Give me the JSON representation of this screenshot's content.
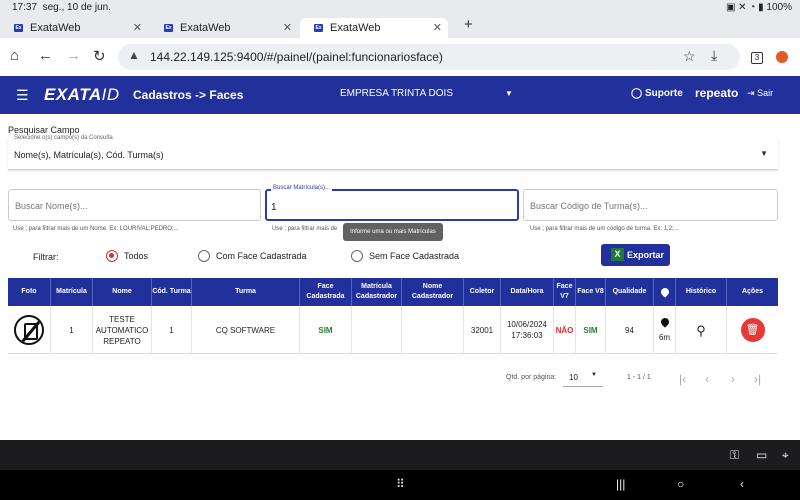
{
  "statusbar": {
    "time": "17:37",
    "date": "seg., 10 de jun.",
    "battery": "100%"
  },
  "tabs": [
    {
      "label": "ExataWeb",
      "favicon": "Ex"
    },
    {
      "label": "ExataWeb",
      "favicon": "Ex"
    },
    {
      "label": "ExataWeb",
      "favicon": "Ex"
    }
  ],
  "browser": {
    "url": "144.22.149.125:9400/#/painel/(painel:funcionariosface)",
    "tab_count": "3"
  },
  "header": {
    "logo_main": "EXATA",
    "logo_id": "ID",
    "breadcrumb": "Cadastros -> Faces",
    "company": "EMPRESA TRINTA DOIS",
    "support": "Suporte",
    "user": "repeato",
    "logout": "Sair"
  },
  "search": {
    "title": "Pesquisar Campo",
    "select_hint": "Selecione o(s) campo(s) da Consulta",
    "select_value": "Nome(s), Matrícula(s), Cód. Turma(s)",
    "name_placeholder": "Buscar Nome(s)...",
    "name_helper": "Use ; para filtrar mais de um Nome. Ex: LOURIVAL;PEDRO;...",
    "matricula_label": "Buscar Matrícula(s)...",
    "matricula_value": "1",
    "matricula_helper": "Use ; para filtrar mais de",
    "turma_placeholder": "Buscar Código de Turma(s)...",
    "turma_helper": "Use ; para filtrar mais de um código de turma. Ex: 1;2;...",
    "tooltip": "Informe uma ou mais Matrículas"
  },
  "filter": {
    "label": "Filtrar:",
    "options": [
      "Todos",
      "Com Face Cadastrada",
      "Sem Face Cadastrada"
    ],
    "selected": "Todos"
  },
  "export_label": "Exportar",
  "table": {
    "headers": [
      "Foto",
      "Matrícula",
      "Nome",
      "Cód. Turma",
      "Turma",
      "Face Cadastrada",
      "Matrícula Cadastrador",
      "Nome Cadastrador",
      "Coletor",
      "Data/Hora",
      "Face V7",
      "Face V8",
      "Qualidade",
      "",
      "Histórico",
      "Ações"
    ],
    "rows": [
      {
        "matricula": "1",
        "nome": "TESTE AUTOMATICO REPEATO",
        "cod_turma": "1",
        "turma": "CQ SOFTWARE",
        "face_cadastrada": "SIM",
        "matricula_cadastrador": "",
        "nome_cadastrador": "",
        "coletor": "32001",
        "data_hora": "10/06/2024 17:36:03",
        "face_v7": "NÃO",
        "face_v8": "SIM",
        "qualidade": "94",
        "distancia": "6m"
      }
    ]
  },
  "paginator": {
    "per_page_label": "Qtd. por página:",
    "per_page": "10",
    "range": "1 - 1 / 1"
  },
  "colors": {
    "primary": "#22309c",
    "danger": "#e53935",
    "success": "#2e7d32"
  }
}
